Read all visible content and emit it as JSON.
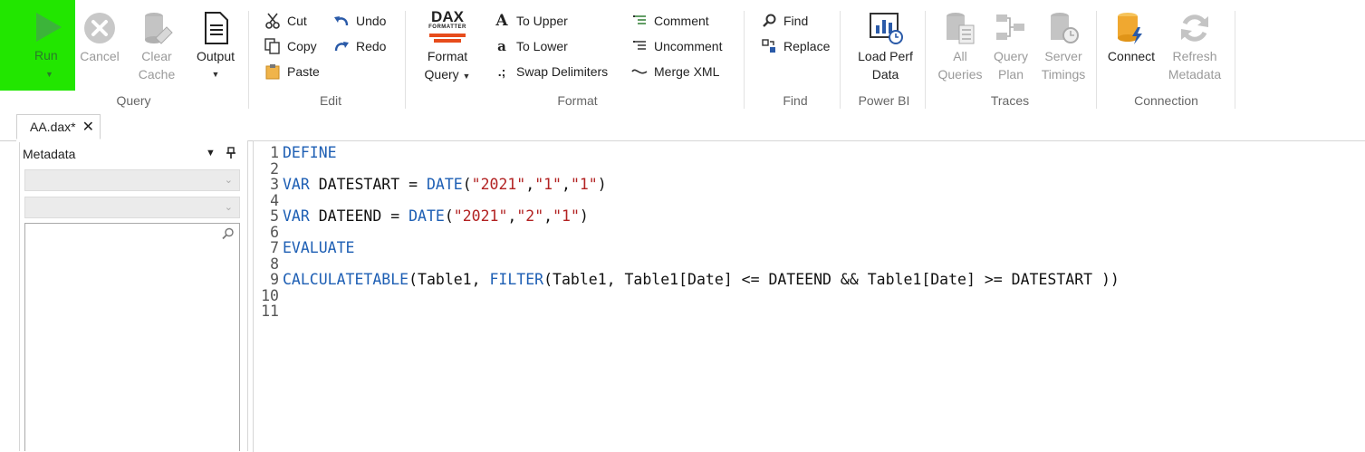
{
  "ribbon": {
    "groups": {
      "query": "Query",
      "edit": "Edit",
      "format": "Format",
      "find": "Find",
      "powerbi": "Power BI",
      "traces": "Traces",
      "connection": "Connection"
    },
    "query": {
      "run": "Run",
      "cancel": "Cancel",
      "clear_cache_1": "Clear",
      "clear_cache_2": "Cache",
      "output": "Output"
    },
    "edit": {
      "cut": "Cut",
      "copy": "Copy",
      "paste": "Paste",
      "undo": "Undo",
      "redo": "Redo"
    },
    "format": {
      "dax_logo_1": "DAX",
      "dax_logo_2": "FORMATTER",
      "format_query_1": "Format",
      "format_query_2": "Query",
      "to_upper": "To Upper",
      "to_lower": "To Lower",
      "swap_delimiters": "Swap Delimiters",
      "comment": "Comment",
      "uncomment": "Uncomment",
      "merge_xml": "Merge XML"
    },
    "find": {
      "find": "Find",
      "replace": "Replace"
    },
    "powerbi": {
      "load_perf_1": "Load Perf",
      "load_perf_2": "Data"
    },
    "traces": {
      "all_queries_1": "All",
      "all_queries_2": "Queries",
      "query_plan_1": "Query",
      "query_plan_2": "Plan",
      "server_timings_1": "Server",
      "server_timings_2": "Timings"
    },
    "connection": {
      "connect": "Connect",
      "refresh_1": "Refresh",
      "refresh_2": "Metadata"
    }
  },
  "tab": {
    "title": "AA.dax*",
    "close": "✕"
  },
  "metadata": {
    "title": "Metadata",
    "dropdown_glyph": "▼",
    "pin_glyph": "📌"
  },
  "editor": {
    "line_numbers": [
      "1",
      "2",
      "3",
      "4",
      "5",
      "6",
      "7",
      "8",
      "9",
      "10",
      "11"
    ],
    "l1": {
      "kw": "DEFINE"
    },
    "l3": {
      "kw1": "VAR",
      "name": " DATESTART = ",
      "fn": "DATE",
      "p1": "(",
      "s1": "\"2021\"",
      "c1": ",",
      "s2": "\"1\"",
      "c2": ",",
      "s3": "\"1\"",
      "p2": ")"
    },
    "l5": {
      "kw1": "VAR",
      "name": " DATEEND = ",
      "fn": "DATE",
      "p1": "(",
      "s1": "\"2021\"",
      "c1": ",",
      "s2": "\"2\"",
      "c2": ",",
      "s3": "\"1\"",
      "p2": ")"
    },
    "l7": {
      "kw": "EVALUATE"
    },
    "l9": {
      "fn1": "CALCULATETABLE",
      "t1": "(Table1, ",
      "fn2": "FILTER",
      "t2": "(Table1, Table1[Date] <= DATEEND && Table1[Date] >= DATESTART ))"
    }
  },
  "colors": {
    "run_highlight": "#22e600",
    "keyword": "#1e5fb4",
    "string": "#b22222"
  }
}
